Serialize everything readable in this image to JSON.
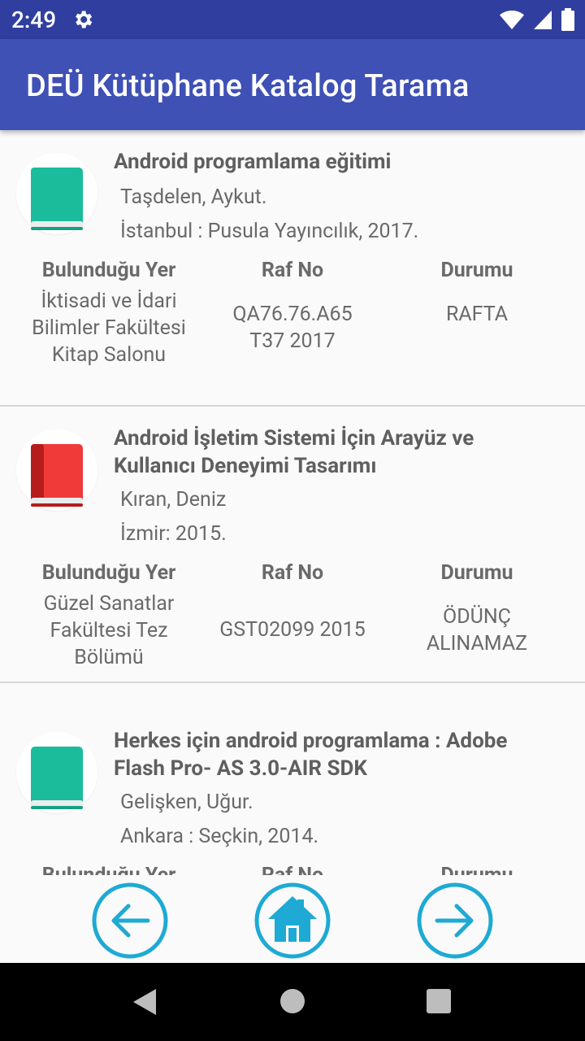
{
  "status_bar": {
    "time": "2:49",
    "icons": [
      "settings-icon",
      "wifi-icon",
      "signal-icon",
      "battery-icon"
    ]
  },
  "app_bar": {
    "title": "DEÜ Kütüphane Katalog Tarama"
  },
  "columns": {
    "location": "Bulunduğu Yer",
    "shelf": "Raf No",
    "status": "Durumu"
  },
  "books": [
    {
      "icon_color": "#1abc9c",
      "title": "Android programlama eğitimi",
      "author": "Taşdelen, Aykut.",
      "publisher": "İstanbul : Pusula Yayıncılık, 2017.",
      "location": [
        "İktisadi ve İdari",
        "Bilimler Fakültesi",
        "Kitap Salonu"
      ],
      "shelf": [
        "QA76.76.A65",
        "T37 2017"
      ],
      "status": [
        "RAFTA"
      ]
    },
    {
      "icon_color": "#f03a3a",
      "title_lines": [
        "Android İşletim Sistemi İçin Arayüz ve",
        "Kullanıcı Deneyimi Tasarımı"
      ],
      "author": "Kıran, Deniz",
      "publisher": "İzmir: 2015.",
      "location": [
        "Güzel Sanatlar",
        "Fakültesi Tez",
        "Bölümü"
      ],
      "shelf": [
        "GST02099 2015"
      ],
      "status": [
        "ÖDÜNÇ",
        "ALINAMAZ"
      ]
    },
    {
      "icon_color": "#1abc9c",
      "title_lines": [
        "Herkes için android programlama : Adobe",
        "Flash Pro- AS 3.0-AIR SDK"
      ],
      "author": "Gelişken, Uğur.",
      "publisher": "Ankara : Seçkin, 2014."
    }
  ],
  "bottom_nav": [
    "back-arrow-icon",
    "home-icon",
    "forward-arrow-icon"
  ],
  "colors": {
    "primary": "#3f51b5",
    "primary_dark": "#303f9f",
    "accent": "#1eaad4",
    "book_green": "#1abc9c",
    "book_red": "#f03a3a"
  }
}
